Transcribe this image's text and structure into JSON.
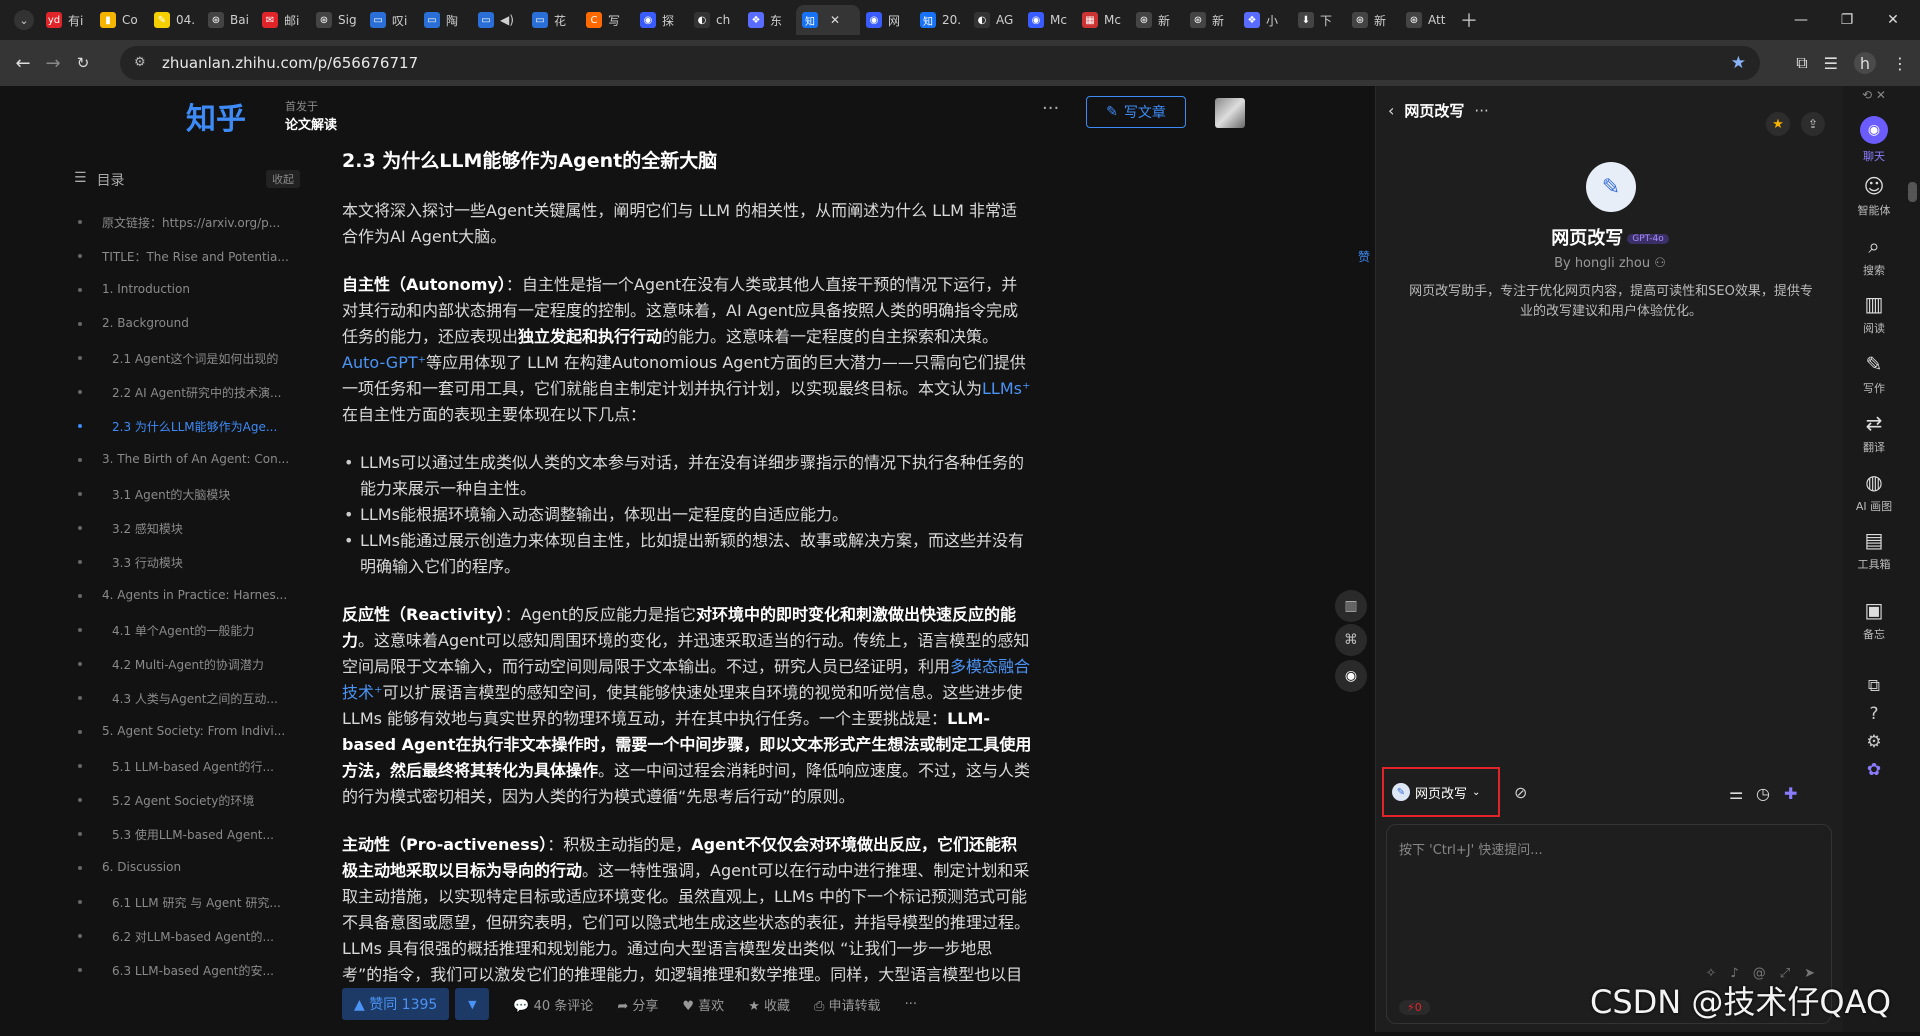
{
  "tabs": [
    {
      "label": "有i",
      "color": "#e0252a",
      "glyph": "yd"
    },
    {
      "label": "Co",
      "color": "#f5b400",
      "glyph": "▮"
    },
    {
      "label": "04.",
      "color": "#f5d000",
      "glyph": "✎"
    },
    {
      "label": "Bai",
      "color": "#444",
      "glyph": "⊛"
    },
    {
      "label": "邮i",
      "color": "#e0252a",
      "glyph": "✉"
    },
    {
      "label": "Sig",
      "color": "#444",
      "glyph": "⊛"
    },
    {
      "label": "叹i",
      "color": "#2a6fd8",
      "glyph": "▭"
    },
    {
      "label": "陶",
      "color": "#2a6fd8",
      "glyph": "▭"
    },
    {
      "label": "◀)",
      "color": "#2a6fd8",
      "glyph": "▭"
    },
    {
      "label": "花",
      "color": "#2a6fd8",
      "glyph": "▭"
    },
    {
      "label": "写",
      "color": "#ff6a00",
      "glyph": "C"
    },
    {
      "label": "探",
      "color": "#3a5cff",
      "glyph": "◉"
    },
    {
      "label": "ch",
      "color": "#333",
      "glyph": "◐"
    },
    {
      "label": "东",
      "color": "#5a6cff",
      "glyph": "❖"
    },
    {
      "label": "",
      "color": "#1772f6",
      "glyph": "知",
      "active": true
    },
    {
      "label": "网",
      "color": "#3a5cff",
      "glyph": "◉"
    },
    {
      "label": "20.",
      "color": "#1772f6",
      "glyph": "知"
    },
    {
      "label": "AG",
      "color": "#333",
      "glyph": "◐"
    },
    {
      "label": "Mc",
      "color": "#3a5cff",
      "glyph": "◉"
    },
    {
      "label": "Mc",
      "color": "#c33",
      "glyph": "▦"
    },
    {
      "label": "新",
      "color": "#444",
      "glyph": "⊛"
    },
    {
      "label": "新",
      "color": "#444",
      "glyph": "⊛"
    },
    {
      "label": "小",
      "color": "#5a6cff",
      "glyph": "❖"
    },
    {
      "label": "下",
      "color": "#444",
      "glyph": "⬇"
    },
    {
      "label": "新",
      "color": "#444",
      "glyph": "⊛"
    },
    {
      "label": "Att",
      "color": "#444",
      "glyph": "⊛"
    }
  ],
  "address": {
    "url": "zhuanlan.zhihu.com/p/656676717"
  },
  "header": {
    "logo": "知乎",
    "publish_label": "首发于",
    "column": "论文解读",
    "write_button": "写文章"
  },
  "toc": {
    "title": "目录",
    "collapse": "收起",
    "items": [
      {
        "label": "原文链接：https://arxiv.org/p...",
        "level": 1
      },
      {
        "label": "TITLE：The Rise and Potentia...",
        "level": 1
      },
      {
        "label": "1. Introduction",
        "level": 1
      },
      {
        "label": "2. Background",
        "level": 1
      },
      {
        "label": "2.1 Agent这个词是如何出现的",
        "level": 2
      },
      {
        "label": "2.2 AI Agent研究中的技术演...",
        "level": 2
      },
      {
        "label": "2.3 为什么LLM能够作为Age...",
        "level": 2,
        "active": true
      },
      {
        "label": "3. The Birth of An Agent: Con...",
        "level": 1
      },
      {
        "label": "3.1 Agent的大脑模块",
        "level": 2
      },
      {
        "label": "3.2 感知模块",
        "level": 2
      },
      {
        "label": "3.3 行动模块",
        "level": 2
      },
      {
        "label": "4. Agents in Practice: Harnes...",
        "level": 1
      },
      {
        "label": "4.1 单个Agent的一般能力",
        "level": 2
      },
      {
        "label": "4.2 Multi-Agent的协调潜力",
        "level": 2
      },
      {
        "label": "4.3 人类与Agent之间的互动...",
        "level": 2
      },
      {
        "label": "5. Agent Society: From Indivi...",
        "level": 1
      },
      {
        "label": "5.1 LLM-based Agent的行...",
        "level": 2
      },
      {
        "label": "5.2 Agent Society的环境",
        "level": 2
      },
      {
        "label": "5.3 使用LLM-based Agent...",
        "level": 2
      },
      {
        "label": "6. Discussion",
        "level": 1
      },
      {
        "label": "6.1 LLM 研究 与 Agent 研究...",
        "level": 2
      },
      {
        "label": "6.2 对LLM-based Agent的...",
        "level": 2
      },
      {
        "label": "6.3 LLM-based Agent的安...",
        "level": 2
      }
    ]
  },
  "article": {
    "heading": "2.3 为什么LLM能够作为Agent的全新大脑",
    "intro": "本文将深入探讨一些Agent关键属性，阐明它们与 LLM 的相关性，从而阐述为什么 LLM 非常适合作为AI Agent大脑。",
    "autonomy": {
      "term": "自主性（Autonomy）",
      "t1": "：自主性是指一个Agent在没有人类或其他人直接干预的情况下运行，并对其行动和内部状态拥有一定程度的控制。这意味着，AI Agent应具备按照人类的明确指令完成任务的能力，还应表现出",
      "b1": "独立发起和执行行动",
      "t2": "的能力。这意味着一定程度的自主探索和决策。",
      "link1": "Auto-GPT⁺",
      "t3": "等应用体现了 LLM 在构建Autonomious Agent方面的巨大潜力——只需向它们提供一项任务和一套可用工具，它们就能自主制定计划并执行计划，以实现最终目标。本文认为",
      "link2": "LLMs⁺",
      "t4": "在自主性方面的表现主要体现在以下几点："
    },
    "bullets": [
      "LLMs可以通过生成类似人类的文本参与对话，并在没有详细步骤指示的情况下执行各种任务的能力来展示一种自主性。",
      "LLMs能根据环境输入动态调整输出，体现出一定程度的自适应能力。",
      "LLMs能通过展示创造力来体现自主性，比如提出新颖的想法、故事或解决方案，而这些并没有明确输入它们的程序。"
    ],
    "reactivity": {
      "term": "反应性（Reactivity）",
      "t1": "：Agent的反应能力是指它",
      "b1": "对环境中的即时变化和刺激做出快速反应的能力",
      "t2": "。这意味着Agent可以感知周围环境的变化，并迅速采取适当的行动。传统上，语言模型的感知空间局限于文本输入，而行动空间则局限于文本输出。不过，研究人员已经证明，利用",
      "link1": "多模态融合技术⁺",
      "t3": "可以扩展语言模型的感知空间，使其能够快速处理来自环境的视觉和听觉信息。这些进步使 LLMs 能够有效地与真实世界的物理环境互动，并在其中执行任务。一个主要挑战是：",
      "b2": "LLM-based Agent在执行非文本操作时，需要一个中间步骤，即以文本形式产生想法或制定工具使用方法，然后最终将其转化为具体操作",
      "t4": "。这一中间过程会消耗时间，降低响应速度。不过，这与人类的行为模式密切相关，因为人类的行为模式遵循“先思考后行动”的原则。"
    },
    "proactive": {
      "term": "主动性（Pro-activeness）",
      "t1": "：积极主动指的是，",
      "b1": "Agent不仅仅会对环境做出反应，它们还能积极主动地采取以目标为导向的行动",
      "t2": "。这一特性强调，Agent可以在行动中进行推理、制定计划和采取主动措施，以实现特定目标或适应环境变化。虽然直观上，LLMs 中的下一个标记预测范式可能不具备意图或愿望，但研究表明，它们可以隐式地生成这些状态的表征，并指导模型的推理过程。LLMs 具有很强的概括推理和规划能力。通过向大型语言模型发出类似 “让我们一步一步地思考”的指令，我们可以激发它们的推理能力，如逻辑推理和数学推理。同样，大型语言模型也以目标"
    }
  },
  "actions": {
    "upvote": "▲ 赞同 1395",
    "downvote": "▼",
    "comments": "40 条评论",
    "share": "分享",
    "like": "喜欢",
    "fav": "收藏",
    "repost": "申请转载",
    "more": "···"
  },
  "float_tip": "赞",
  "panel": {
    "title": "网页改写",
    "bot_name": "网页改写",
    "bot_badge": "GPT-4o",
    "author": "By hongli zhou",
    "description": "网页改写助手，专注于优化网页内容，提高可读性和SEO效果，提供专业的改写建议和用户体验优化。",
    "selected_bot": "网页改写",
    "input_placeholder": "按下 'Ctrl+J' 快速提问...",
    "credits": "0"
  },
  "rail": [
    {
      "label": "聊天",
      "icon": "chat-icon",
      "active": true
    },
    {
      "label": "智能体",
      "icon": "agent-icon"
    },
    {
      "label": "搜索",
      "icon": "search-icon"
    },
    {
      "label": "阅读",
      "icon": "book-icon"
    },
    {
      "label": "写作",
      "icon": "pen-icon"
    },
    {
      "label": "翻译",
      "icon": "translate-icon"
    },
    {
      "label": "AI 画图",
      "icon": "palette-icon"
    },
    {
      "label": "工具箱",
      "icon": "toolbox-icon"
    },
    {
      "label": "备忘",
      "icon": "memo-icon"
    }
  ],
  "watermark": "CSDN @技术仔QAQ"
}
